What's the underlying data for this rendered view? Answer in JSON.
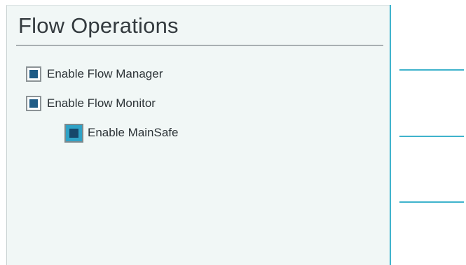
{
  "page": {
    "title": "Flow Operations"
  },
  "options": [
    {
      "label": "Enable Flow Manager",
      "checked": true
    },
    {
      "label": "Enable Flow Monitor",
      "checked": true
    },
    {
      "label": "Enable MainSafe",
      "checked": true,
      "selected": true
    }
  ],
  "colors": {
    "accent": "#3fb3cc",
    "checkbox_fill": "#1f5c86",
    "selected_fill": "#2fa2c6",
    "panel_background": "#f1f7f6"
  }
}
